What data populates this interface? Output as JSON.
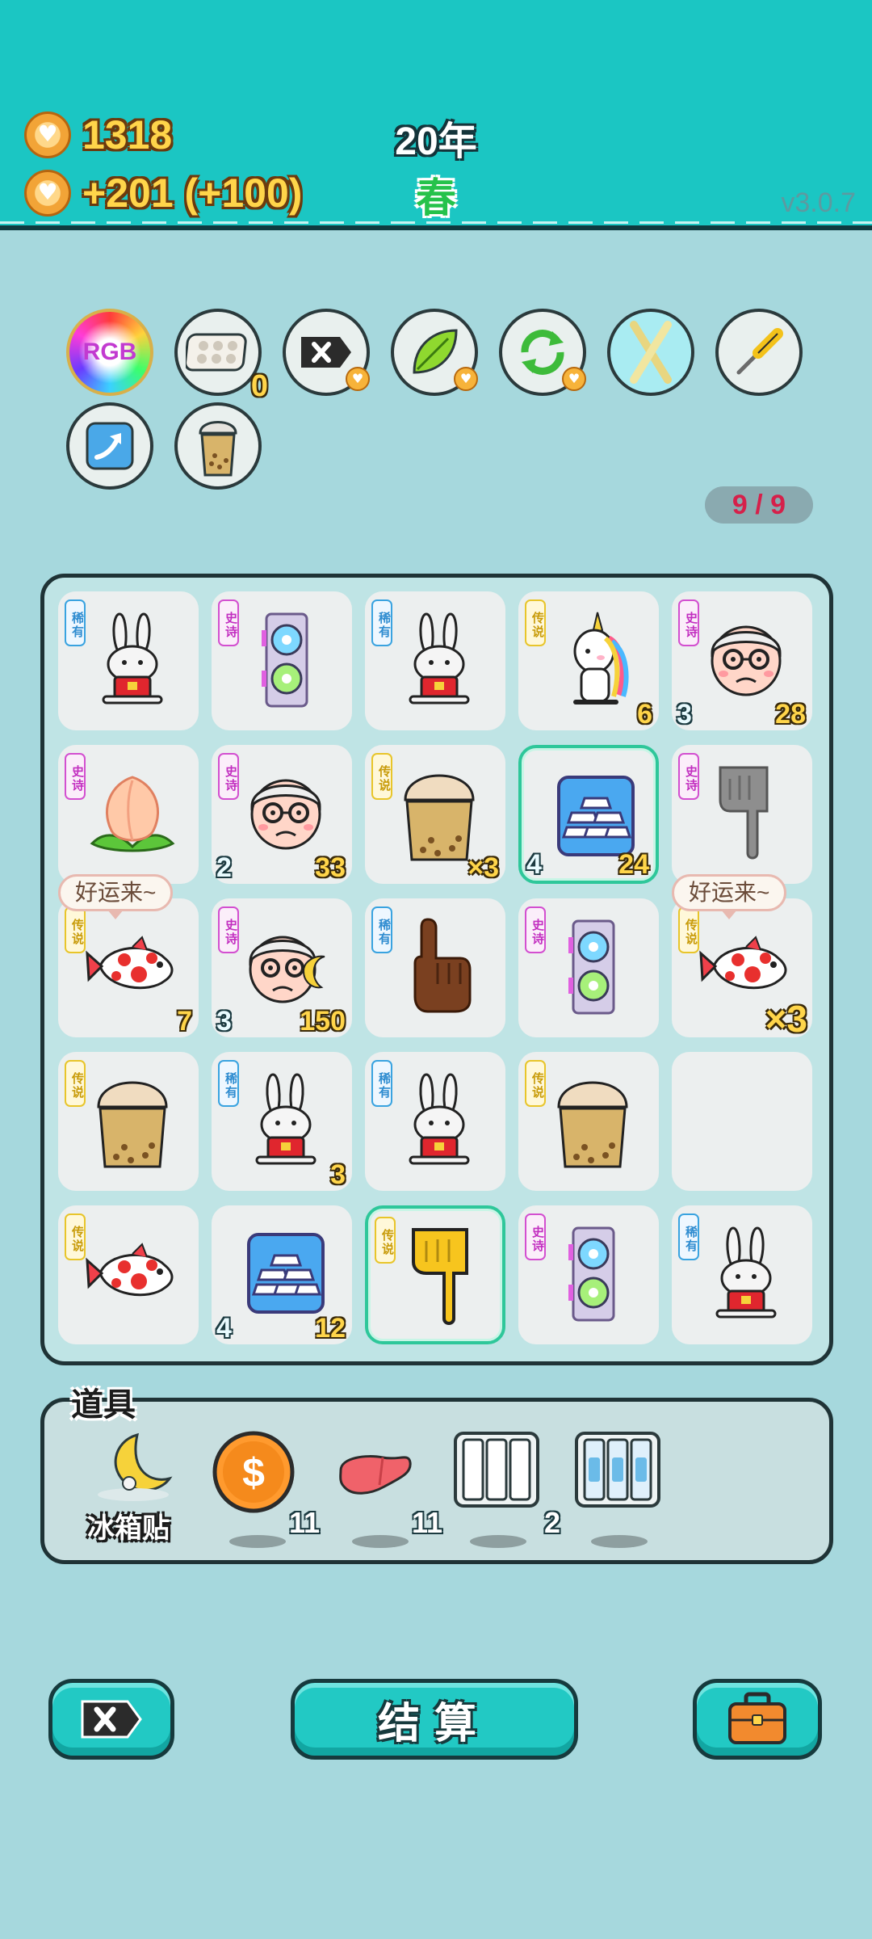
{
  "header": {
    "coins": "1318",
    "income": "+201 (+100)",
    "year": "20年",
    "season": "春",
    "version": "v3.0.7",
    "colors": {
      "bar": "#1bc6c3",
      "gold": "#ffd54a",
      "season": "#25c24b"
    }
  },
  "skills": [
    {
      "icon": "rgb-icon",
      "label": "RGB"
    },
    {
      "icon": "egg-tray-icon",
      "count": "0"
    },
    {
      "icon": "delete-tag-icon"
    },
    {
      "icon": "leaf-icon"
    },
    {
      "icon": "refresh-icon"
    },
    {
      "icon": "crossed-sticks-icon"
    },
    {
      "icon": "screwdriver-icon"
    },
    {
      "icon": "arrow-up-card-icon"
    },
    {
      "icon": "bubble-tea-icon"
    }
  ],
  "progress": "9 / 9",
  "rarity_labels": {
    "rare": "稀有",
    "epic": "史诗",
    "legend": "传说"
  },
  "board": {
    "cells": [
      {
        "icon": "rabbit-icon",
        "rarity": "稀有"
      },
      {
        "icon": "gpu-icon",
        "rarity": "史诗"
      },
      {
        "icon": "rabbit-icon",
        "rarity": "稀有"
      },
      {
        "icon": "unicorn-icon",
        "rarity": "传说",
        "value": "6"
      },
      {
        "icon": "grandpa-icon",
        "rarity": "史诗",
        "left": "3",
        "value": "28"
      },
      {
        "icon": "peach-icon",
        "rarity": "史诗"
      },
      {
        "icon": "grandpa-icon",
        "rarity": "史诗",
        "left": "2",
        "value": "33"
      },
      {
        "icon": "bubble-tea-icon",
        "rarity": "传说",
        "value": "×3"
      },
      {
        "icon": "silver-bars-icon",
        "left": "4",
        "value": "24",
        "selected": true
      },
      {
        "icon": "grey-finger-icon",
        "rarity": "史诗"
      },
      {
        "icon": "koi-fish-icon",
        "rarity": "传说",
        "value": "7",
        "bubble": "好运来~"
      },
      {
        "icon": "grandpa-moon-icon",
        "rarity": "史诗",
        "left": "3",
        "value": "150"
      },
      {
        "icon": "brown-finger-icon",
        "rarity": "稀有"
      },
      {
        "icon": "gpu-icon",
        "rarity": "史诗"
      },
      {
        "icon": "koi-fish-icon",
        "rarity": "传说",
        "value": "×3",
        "big": true,
        "bubble": "好运来~"
      },
      {
        "icon": "bubble-tea-icon",
        "rarity": "传说"
      },
      {
        "icon": "rabbit-icon",
        "rarity": "稀有",
        "value": "3"
      },
      {
        "icon": "rabbit-icon",
        "rarity": "稀有"
      },
      {
        "icon": "bubble-tea-icon",
        "rarity": "传说"
      },
      {
        "icon": "empty"
      },
      {
        "icon": "koi-fish-icon",
        "rarity": "传说"
      },
      {
        "icon": "silver-bars-icon",
        "left": "4",
        "value": "12"
      },
      {
        "icon": "yellow-finger-icon",
        "rarity": "传说",
        "selected": true
      },
      {
        "icon": "gpu-icon",
        "rarity": "史诗"
      },
      {
        "icon": "rabbit-icon",
        "rarity": "稀有"
      }
    ]
  },
  "items": {
    "title": "道具",
    "list": [
      {
        "icon": "moon-fridge-magnet-icon",
        "label": "冰箱贴"
      },
      {
        "icon": "dollar-coin-icon",
        "qty": "11"
      },
      {
        "icon": "liver-icon",
        "qty": "11"
      },
      {
        "icon": "three-slot-card-icon",
        "qty": "2"
      },
      {
        "icon": "rare-slot-card-icon"
      }
    ]
  },
  "buttons": {
    "delete_icon": "delete-tag-icon",
    "settle": "结算",
    "bag_icon": "briefcase-icon"
  }
}
